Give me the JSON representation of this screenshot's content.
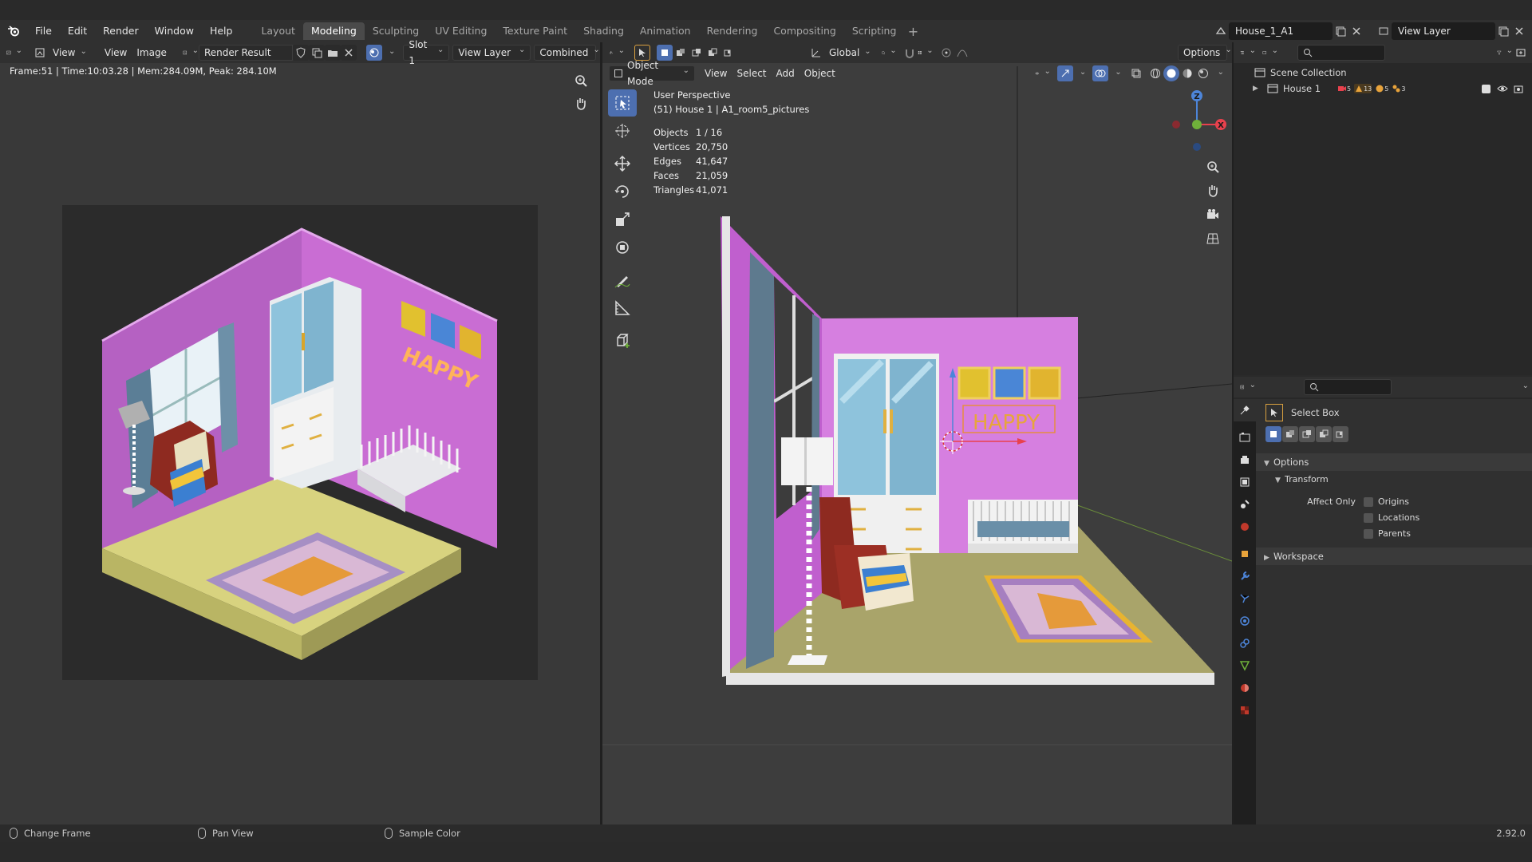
{
  "menu": [
    "File",
    "Edit",
    "Render",
    "Window",
    "Help"
  ],
  "workspaces": [
    "Layout",
    "Modeling",
    "Sculpting",
    "UV Editing",
    "Texture Paint",
    "Shading",
    "Animation",
    "Rendering",
    "Compositing",
    "Scripting"
  ],
  "active_workspace": "Modeling",
  "scene_name": "House_1_A1",
  "view_layer": "View Layer",
  "image_editor": {
    "view_menu": "View",
    "view_menu2": "View",
    "image_menu": "Image",
    "image_name": "Render Result",
    "slot": "Slot 1",
    "view_layer": "View Layer",
    "pass": "Combined",
    "frame_info": "Frame:51 | Time:10:03.28 | Mem:284.09M, Peak: 284.10M"
  },
  "viewport": {
    "orientation": "Global",
    "options": "Options",
    "mode": "Object Mode",
    "menus": [
      "View",
      "Select",
      "Add",
      "Object"
    ],
    "perspective": "User Perspective",
    "object_path": "(51) House 1 | A1_room5_pictures",
    "stats": [
      {
        "k": "Objects",
        "v": "1 / 16"
      },
      {
        "k": "Vertices",
        "v": "20,750"
      },
      {
        "k": "Edges",
        "v": "41,647"
      },
      {
        "k": "Faces",
        "v": "21,059"
      },
      {
        "k": "Triangles",
        "v": "41,071"
      }
    ],
    "sign_text": "HAPPY",
    "gizmo": {
      "x": "X",
      "y": "Y",
      "z": "Z"
    }
  },
  "outliner": {
    "root": "Scene Collection",
    "item": "House 1",
    "badges": [
      "5",
      "13",
      "5",
      "3"
    ]
  },
  "properties": {
    "tool_name": "Select Box",
    "options_label": "Options",
    "transform_label": "Transform",
    "affect_only": "Affect Only",
    "checks": [
      "Origins",
      "Locations",
      "Parents"
    ],
    "workspace_label": "Workspace"
  },
  "statusbar": {
    "left": "Change Frame",
    "mid": "Pan View",
    "right": "Sample Color",
    "version": "2.92.0"
  },
  "colors": {
    "accent": "#4d6fb0",
    "wall": "#c05fce",
    "floor": "#a9a46a",
    "x_axis": "#e8414d",
    "y_axis": "#6fb03a",
    "z_axis": "#4d85d9"
  }
}
